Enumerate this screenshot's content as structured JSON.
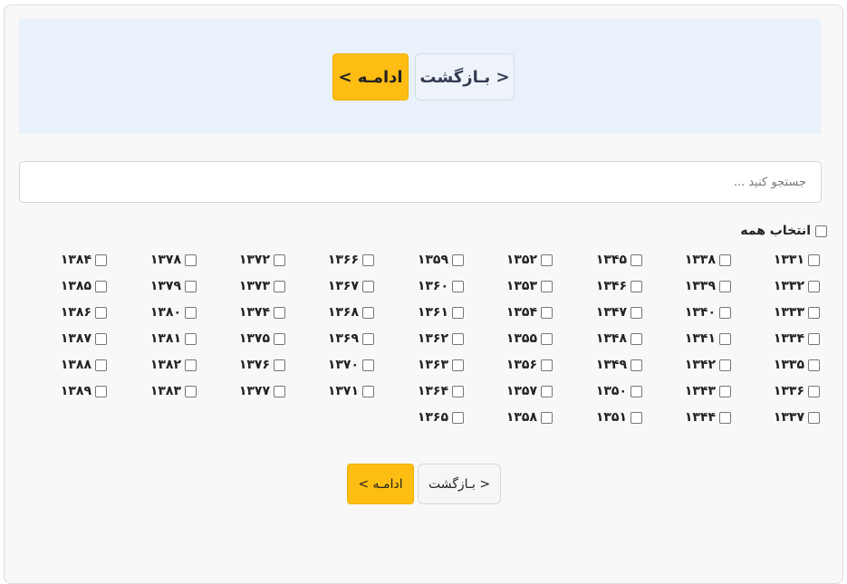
{
  "top_actions": {
    "back_label": "< بـازگشت",
    "continue_label": "ادامـه >"
  },
  "search": {
    "placeholder": "جستجو کنید ...",
    "value": ""
  },
  "select_all": {
    "label": "انتخاب همه",
    "checked": false
  },
  "years": [
    [
      "۱۳۳۱",
      "۱۳۳۲",
      "۱۳۳۳",
      "۱۳۳۴",
      "۱۳۳۵",
      "۱۳۳۶",
      "۱۳۳۷"
    ],
    [
      "۱۳۳۸",
      "۱۳۳۹",
      "۱۳۴۰",
      "۱۳۴۱",
      "۱۳۴۲",
      "۱۳۴۳",
      "۱۳۴۴"
    ],
    [
      "۱۳۴۵",
      "۱۳۴۶",
      "۱۳۴۷",
      "۱۳۴۸",
      "۱۳۴۹",
      "۱۳۵۰",
      "۱۳۵۱"
    ],
    [
      "۱۳۵۲",
      "۱۳۵۳",
      "۱۳۵۴",
      "۱۳۵۵",
      "۱۳۵۶",
      "۱۳۵۷",
      "۱۳۵۸"
    ],
    [
      "۱۳۵۹",
      "۱۳۶۰",
      "۱۳۶۱",
      "۱۳۶۲",
      "۱۳۶۳",
      "۱۳۶۴",
      "۱۳۶۵"
    ],
    [
      "۱۳۶۶",
      "۱۳۶۷",
      "۱۳۶۸",
      "۱۳۶۹",
      "۱۳۷۰",
      "۱۳۷۱"
    ],
    [
      "۱۳۷۲",
      "۱۳۷۳",
      "۱۳۷۴",
      "۱۳۷۵",
      "۱۳۷۶",
      "۱۳۷۷"
    ],
    [
      "۱۳۷۸",
      "۱۳۷۹",
      "۱۳۸۰",
      "۱۳۸۱",
      "۱۳۸۲",
      "۱۳۸۳"
    ],
    [
      "۱۳۸۴",
      "۱۳۸۵",
      "۱۳۸۶",
      "۱۳۸۷",
      "۱۳۸۸",
      "۱۳۸۹"
    ]
  ],
  "bottom_actions": {
    "back_label": "< بـازگشت",
    "continue_label": "ادامـه >"
  }
}
